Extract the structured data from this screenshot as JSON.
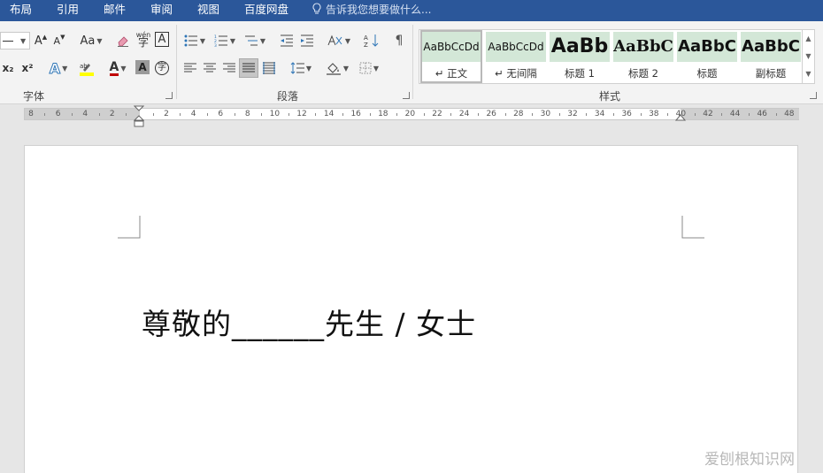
{
  "menu": {
    "tabs": [
      "布局",
      "引用",
      "邮件",
      "审阅",
      "视图",
      "百度网盘"
    ],
    "tell_me": "告诉我您想要做什么..."
  },
  "ribbon": {
    "font_group": {
      "label": "字体",
      "grow_font": "A",
      "shrink_font": "A",
      "change_case": "Aa",
      "subscript": "x₂",
      "superscript": "x²",
      "font_color": "A",
      "char_shading": "A",
      "phonetic_top": "wén",
      "phonetic_char": "字",
      "border_char": "A",
      "enclose_char": "字"
    },
    "paragraph_group": {
      "label": "段落"
    },
    "styles_group": {
      "label": "样式",
      "styles": [
        {
          "preview": "AaBbCcDd",
          "name": "↵ 正文"
        },
        {
          "preview": "AaBbCcDd",
          "name": "↵ 无间隔"
        },
        {
          "preview": "AaBb",
          "name": "标题 1"
        },
        {
          "preview": "AaBbC",
          "name": "标题 2"
        },
        {
          "preview": "AaBbC",
          "name": "标题"
        },
        {
          "preview": "AaBbC",
          "name": "副标题"
        }
      ]
    }
  },
  "ruler": {
    "labels": [
      "8",
      "6",
      "4",
      "2",
      "2",
      "4",
      "6",
      "8",
      "10",
      "12",
      "14",
      "16",
      "18",
      "20",
      "22",
      "24",
      "26",
      "28",
      "30",
      "32",
      "34",
      "36",
      "38",
      "40",
      "42",
      "44",
      "46",
      "48"
    ]
  },
  "document": {
    "text": "尊敬的______先生 / 女士"
  },
  "watermark": "爱刨根知识网",
  "colors": {
    "menubar": "#2b579a",
    "style_preview_bg": "#d3e7d7",
    "highlight_yellow": "#ffff00"
  }
}
